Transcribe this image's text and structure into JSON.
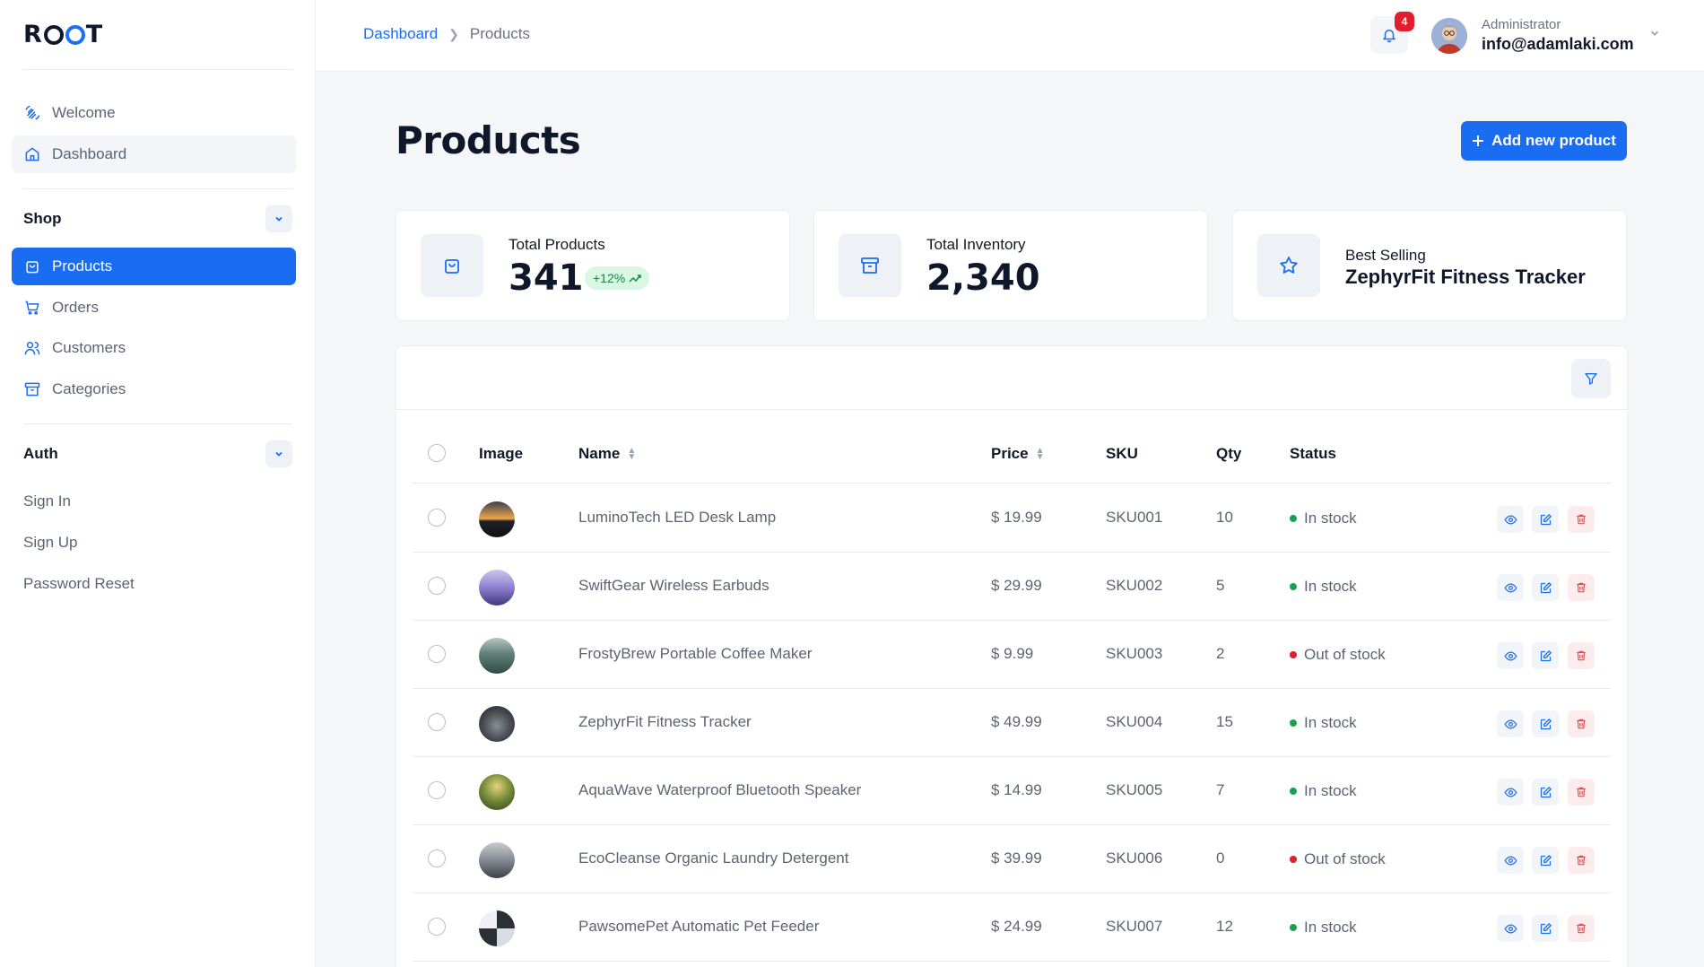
{
  "app": {
    "logo": "ROOT"
  },
  "sidebar": {
    "welcome": "Welcome",
    "dashboard": "Dashboard",
    "shop_heading": "Shop",
    "shop_items": [
      {
        "label": "Products",
        "icon": "shopping-bag-icon",
        "active": true
      },
      {
        "label": "Orders",
        "icon": "cart-icon"
      },
      {
        "label": "Customers",
        "icon": "users-icon"
      },
      {
        "label": "Categories",
        "icon": "archive-icon"
      }
    ],
    "auth_heading": "Auth",
    "auth_items": [
      "Sign In",
      "Sign Up",
      "Password Reset"
    ]
  },
  "topbar": {
    "breadcrumb_root": "Dashboard",
    "breadcrumb_current": "Products",
    "notification_count": "4",
    "user_role": "Administrator",
    "user_email": "info@adamlaki.com"
  },
  "page": {
    "title": "Products",
    "add_button": "Add new product"
  },
  "stats": {
    "total_products_label": "Total Products",
    "total_products_value": "341",
    "total_products_change": "+12%",
    "total_inventory_label": "Total Inventory",
    "total_inventory_value": "2,340",
    "best_selling_label": "Best Selling",
    "best_selling_value": "ZephyrFit Fitness Tracker"
  },
  "table": {
    "headers": {
      "image": "Image",
      "name": "Name",
      "price": "Price",
      "sku": "SKU",
      "qty": "Qty",
      "status": "Status"
    },
    "rows": [
      {
        "name": "LuminoTech LED Desk Lamp",
        "price": "$ 19.99",
        "sku": "SKU001",
        "qty": "10",
        "status": "In stock"
      },
      {
        "name": "SwiftGear Wireless Earbuds",
        "price": "$ 29.99",
        "sku": "SKU002",
        "qty": "5",
        "status": "In stock"
      },
      {
        "name": "FrostyBrew Portable Coffee Maker",
        "price": "$ 9.99",
        "sku": "SKU003",
        "qty": "2",
        "status": "Out of stock"
      },
      {
        "name": "ZephyrFit Fitness Tracker",
        "price": "$ 49.99",
        "sku": "SKU004",
        "qty": "15",
        "status": "In stock"
      },
      {
        "name": "AquaWave Waterproof Bluetooth Speaker",
        "price": "$ 14.99",
        "sku": "SKU005",
        "qty": "7",
        "status": "In stock"
      },
      {
        "name": "EcoCleanse Organic Laundry Detergent",
        "price": "$ 39.99",
        "sku": "SKU006",
        "qty": "0",
        "status": "Out of stock"
      },
      {
        "name": "PawsomePet Automatic Pet Feeder",
        "price": "$ 24.99",
        "sku": "SKU007",
        "qty": "12",
        "status": "In stock"
      }
    ]
  },
  "colors": {
    "accent": "#1a6cf0",
    "in_stock": "#16a34a",
    "out_of_stock": "#e11d2e"
  }
}
